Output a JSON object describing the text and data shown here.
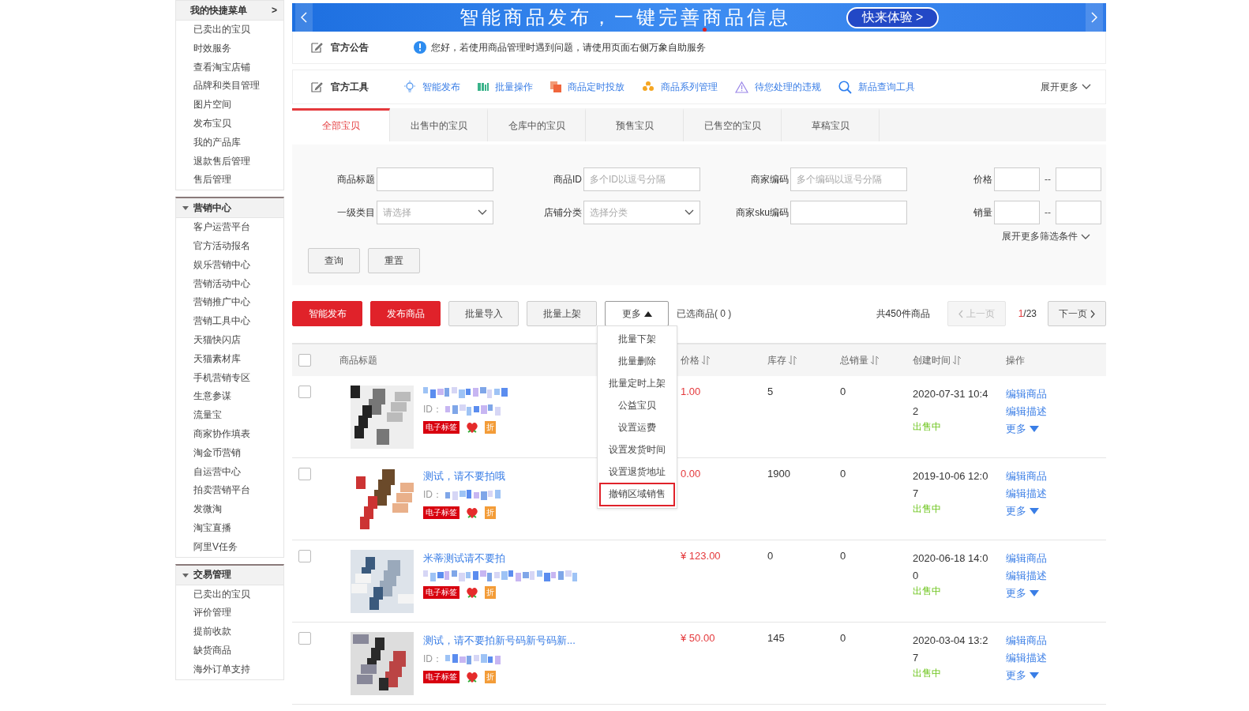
{
  "sidebar": {
    "sections": [
      {
        "kind": "quick",
        "title": "我的快捷菜单",
        "toggle": ">",
        "expanded": true,
        "items": [
          "已卖出的宝贝",
          "时效服务",
          "查看淘宝店铺",
          "品牌和类目管理",
          "图片空间",
          "发布宝贝",
          "我的产品库",
          "退款售后管理",
          "售后管理"
        ]
      },
      {
        "kind": "group",
        "title": "营销中心",
        "expanded": true,
        "items": [
          "客户运营平台",
          "官方活动报名",
          "娱乐营销中心",
          "营销活动中心",
          "营销推广中心",
          "营销工具中心",
          "天猫快闪店",
          "天猫素材库",
          "手机营销专区",
          "生意参谋",
          "流量宝",
          "商家协作填表",
          "淘金币营销",
          "自运营中心",
          "拍卖营销平台",
          "发微淘",
          "淘宝直播",
          "阿里V任务"
        ]
      },
      {
        "kind": "group",
        "title": "交易管理",
        "expanded": true,
        "items": [
          "已卖出的宝贝",
          "评价管理",
          "提前收款",
          "缺货商品",
          "海外订单支持"
        ]
      }
    ]
  },
  "banner": {
    "headline": "智能商品发布，一键完善商品信息",
    "cta": "快来体验 >"
  },
  "notice": {
    "label": "官方公告",
    "message": "您好，若使用商品管理时遇到问题，请使用页面右侧万象自助服务"
  },
  "tools": {
    "label": "官方工具",
    "items": [
      {
        "kind": "bulb",
        "label": "智能发布"
      },
      {
        "kind": "bars",
        "label": "批量操作"
      },
      {
        "kind": "squares",
        "label": "商品定时投放"
      },
      {
        "kind": "flower",
        "label": "商品系列管理"
      },
      {
        "kind": "warning",
        "label": "待您处理的违规"
      },
      {
        "kind": "search",
        "label": "新品查询工具"
      }
    ],
    "more": "展开更多"
  },
  "tabs": [
    {
      "label": "全部宝贝",
      "selected": true
    },
    {
      "label": "出售中的宝贝",
      "selected": false
    },
    {
      "label": "仓库中的宝贝",
      "selected": false
    },
    {
      "label": "预售宝贝",
      "selected": false
    },
    {
      "label": "已售空的宝贝",
      "selected": false
    },
    {
      "label": "草稿宝贝",
      "selected": false
    }
  ],
  "filters": {
    "rows": [
      [
        {
          "kind": "text",
          "label": "商品标题"
        },
        {
          "kind": "text",
          "label": "商品ID",
          "placeholder": "多个ID以逗号分隔"
        },
        {
          "kind": "text",
          "label": "商家编码",
          "placeholder": "多个编码以逗号分隔"
        },
        {
          "kind": "range",
          "label": "价格",
          "separator": "--"
        }
      ],
      [
        {
          "kind": "select",
          "label": "一级类目",
          "placeholder": "请选择"
        },
        {
          "kind": "select",
          "label": "店铺分类",
          "placeholder": "选择分类"
        },
        {
          "kind": "text",
          "label": "商家sku编码"
        },
        {
          "kind": "range",
          "label": "销量",
          "separator": "--"
        }
      ]
    ],
    "more": "展开更多筛选条件",
    "buttons": [
      "查询",
      "重置"
    ]
  },
  "actions": {
    "buttons": [
      {
        "kind": "primary",
        "label": "智能发布"
      },
      {
        "kind": "primary",
        "label": "发布商品"
      },
      {
        "kind": "plain",
        "label": "批量导入"
      },
      {
        "kind": "plain",
        "label": "批量上架"
      },
      {
        "kind": "menu",
        "label": "更多",
        "expanded": true
      }
    ],
    "selected_count": "已选商品( 0 )",
    "total": "共450件商品",
    "prev": {
      "label": "上一页",
      "disabled": true
    },
    "page": "1",
    "pages": "/23",
    "next": {
      "label": "下一页",
      "disabled": false
    }
  },
  "more_menu": {
    "items": [
      {
        "label": "批量下架",
        "selected": false
      },
      {
        "label": "批量删除",
        "selected": false
      },
      {
        "label": "批量定时上架",
        "selected": false
      },
      {
        "label": "公益宝贝",
        "selected": false
      },
      {
        "label": "设置运费",
        "selected": false
      },
      {
        "label": "设置发货时间",
        "selected": false
      },
      {
        "label": "设置退货地址",
        "selected": false
      },
      {
        "label": "撤销区域销售",
        "selected": true
      }
    ]
  },
  "table": {
    "header_checked": false,
    "columns": [
      "商品标题",
      "价格",
      "库存",
      "总销量",
      "创建时间",
      "操作"
    ],
    "rows": [
      {
        "checked": false,
        "title": "",
        "id": "ID：",
        "tag": "电子标签",
        "discount": "折",
        "price": "1.00",
        "stock": "5",
        "sales": "0",
        "created": "2020-07-31 10:42",
        "status": "出售中",
        "actions": [
          "编辑商品",
          "编辑描述",
          "更多"
        ]
      },
      {
        "checked": false,
        "title": "测试，请不要拍哦",
        "id": "ID：",
        "tag": "电子标签",
        "discount": "折",
        "price": "0.00",
        "stock": "1900",
        "sales": "0",
        "created": "2019-10-06 12:07",
        "status": "出售中",
        "actions": [
          "编辑商品",
          "编辑描述",
          "更多"
        ]
      },
      {
        "checked": false,
        "title": "米蒂测试请不要拍",
        "id": "",
        "tag": "电子标签",
        "discount": "折",
        "price": "¥ 123.00",
        "stock": "0",
        "sales": "0",
        "created": "2020-06-18 14:00",
        "status": "出售中",
        "actions": [
          "编辑商品",
          "编辑描述",
          "更多"
        ]
      },
      {
        "checked": false,
        "title": "测试，请不要拍新号码新号码新...",
        "id": "ID：",
        "tag": "电子标签",
        "discount": "折",
        "price": "¥ 50.00",
        "stock": "145",
        "sales": "0",
        "created": "2020-03-04 13:27",
        "status": "出售中",
        "actions": [
          "编辑商品",
          "编辑描述",
          "更多"
        ]
      }
    ]
  }
}
